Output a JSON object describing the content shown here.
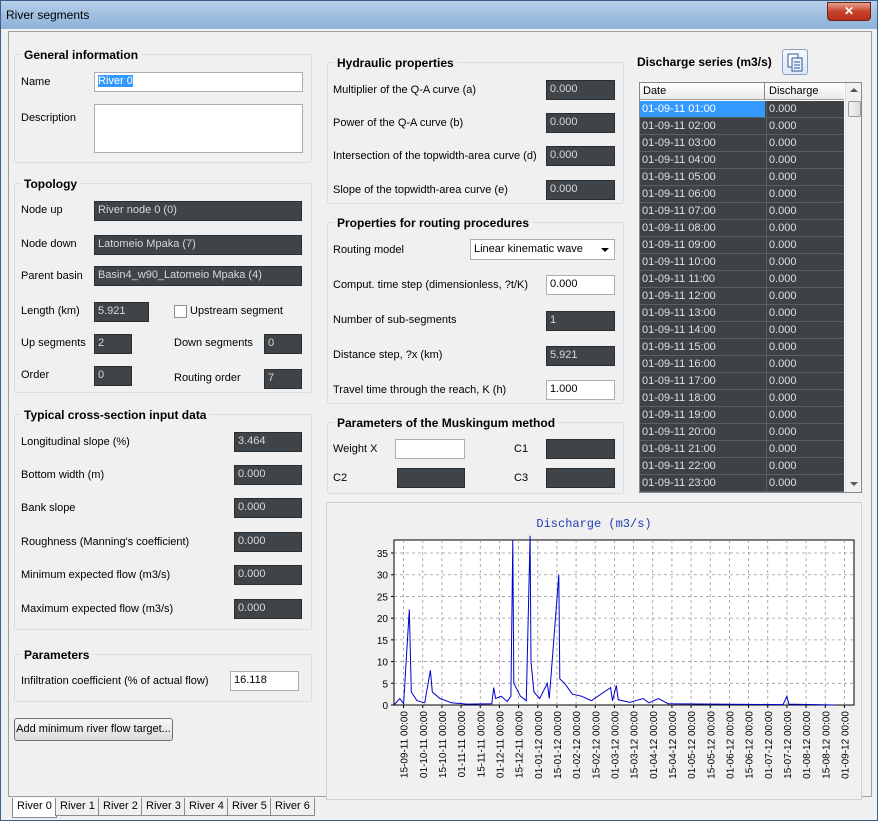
{
  "window": {
    "title": "River segments",
    "close_label": "✕"
  },
  "general": {
    "title": "General information",
    "name_label": "Name",
    "name_value": "River 0",
    "description_label": "Description",
    "description_value": ""
  },
  "topology": {
    "title": "Topology",
    "node_up_label": "Node up",
    "node_up_value": "River node 0 (0)",
    "node_down_label": "Node down",
    "node_down_value": "Latomeio Mpaka (7)",
    "parent_basin_label": "Parent basin",
    "parent_basin_value": "Basin4_w90_Latomeio Mpaka (4)",
    "length_label": "Length (km)",
    "length_value": "5.921",
    "upstream_label": "Upstream segment",
    "up_segments_label": "Up segments",
    "up_segments_value": "2",
    "down_segments_label": "Down segments",
    "down_segments_value": "0",
    "order_label": "Order",
    "order_value": "0",
    "routing_order_label": "Routing order",
    "routing_order_value": "7"
  },
  "cross_section": {
    "title": "Typical cross-section input data",
    "rows": [
      {
        "label": "Longitudinal slope (%)",
        "value": "3.464"
      },
      {
        "label": "Bottom width (m)",
        "value": "0.000"
      },
      {
        "label": "Bank slope",
        "value": "0.000"
      },
      {
        "label": "Roughness (Manning's coefficient)",
        "value": "0.000"
      },
      {
        "label": "Minimum expected flow (m3/s)",
        "value": "0.000"
      },
      {
        "label": "Maximum expected flow (m3/s)",
        "value": "0.000"
      }
    ]
  },
  "parameters": {
    "title": "Parameters",
    "infiltration_label": "Infiltration coefficient (% of actual flow)",
    "infiltration_value": "16.118"
  },
  "add_target_button": "Add minimum river flow target...",
  "hydraulic": {
    "title": "Hydraulic properties",
    "rows": [
      {
        "label": "Multiplier of the Q-A curve (a)",
        "value": "0.000"
      },
      {
        "label": "Power of the Q-A curve (b)",
        "value": "0.000"
      },
      {
        "label": "Intersection of the topwidth-area curve (d)",
        "value": "0.000"
      },
      {
        "label": "Slope of the topwidth-area curve (e)",
        "value": "0.000"
      }
    ]
  },
  "routing": {
    "title": "Properties for routing procedures",
    "model_label": "Routing model",
    "model_value": "Linear kinematic wave",
    "time_step_label": "Comput. time step (dimensionless, ?t/K)",
    "time_step_value": "0.000",
    "sub_segments_label": "Number of sub-segments",
    "sub_segments_value": "1",
    "distance_label": "Distance step, ?x (km)",
    "distance_value": "5.921",
    "travel_label": "Travel time through the reach, K (h)",
    "travel_value": "1.000"
  },
  "muskingum": {
    "title": "Parameters of the Muskingum method",
    "weight_label": "Weight X",
    "weight_value": "",
    "c1_label": "C1",
    "c1_value": "",
    "c2_label": "C2",
    "c2_value": "",
    "c3_label": "C3",
    "c3_value": ""
  },
  "discharge": {
    "title": "Discharge series (m3/s)",
    "col_date": "Date",
    "col_value": "Discharge",
    "rows": [
      {
        "date": "01-09-11 01:00",
        "value": "0.000"
      },
      {
        "date": "01-09-11 02:00",
        "value": "0.000"
      },
      {
        "date": "01-09-11 03:00",
        "value": "0.000"
      },
      {
        "date": "01-09-11 04:00",
        "value": "0.000"
      },
      {
        "date": "01-09-11 05:00",
        "value": "0.000"
      },
      {
        "date": "01-09-11 06:00",
        "value": "0.000"
      },
      {
        "date": "01-09-11 07:00",
        "value": "0.000"
      },
      {
        "date": "01-09-11 08:00",
        "value": "0.000"
      },
      {
        "date": "01-09-11 09:00",
        "value": "0.000"
      },
      {
        "date": "01-09-11 10:00",
        "value": "0.000"
      },
      {
        "date": "01-09-11 11:00",
        "value": "0.000"
      },
      {
        "date": "01-09-11 12:00",
        "value": "0.000"
      },
      {
        "date": "01-09-11 13:00",
        "value": "0.000"
      },
      {
        "date": "01-09-11 14:00",
        "value": "0.000"
      },
      {
        "date": "01-09-11 15:00",
        "value": "0.000"
      },
      {
        "date": "01-09-11 16:00",
        "value": "0.000"
      },
      {
        "date": "01-09-11 17:00",
        "value": "0.000"
      },
      {
        "date": "01-09-11 18:00",
        "value": "0.000"
      },
      {
        "date": "01-09-11 19:00",
        "value": "0.000"
      },
      {
        "date": "01-09-11 20:00",
        "value": "0.000"
      },
      {
        "date": "01-09-11 21:00",
        "value": "0.000"
      },
      {
        "date": "01-09-11 22:00",
        "value": "0.000"
      },
      {
        "date": "01-09-11 23:00",
        "value": "0.000"
      }
    ]
  },
  "tabs": [
    "River 0",
    "River 1",
    "River 2",
    "River 3",
    "River 4",
    "River 5",
    "River 6"
  ],
  "colors": {
    "readonly_bg": "#3f4448",
    "selection": "#3399ff",
    "series": "#0000cc"
  },
  "chart_data": {
    "type": "line",
    "title": "Discharge (m3/s)",
    "xlabel": "",
    "ylabel": "",
    "ylim": [
      0,
      38
    ],
    "yticks": [
      0,
      5,
      10,
      15,
      20,
      25,
      30,
      35
    ],
    "xticks": [
      "15-09-11 00:00",
      "01-10-11 00:00",
      "15-10-11 00:00",
      "01-11-11 00:00",
      "15-11-11 00:00",
      "01-12-11 00:00",
      "15-12-11 00:00",
      "01-01-12 00:00",
      "15-01-12 00:00",
      "01-02-12 00:00",
      "15-02-12 00:00",
      "01-03-12 00:00",
      "15-03-12 00:00",
      "01-04-12 00:00",
      "15-04-12 00:00",
      "01-05-12 00:00",
      "15-05-12 00:00",
      "01-06-12 00:00",
      "15-06-12 00:00",
      "01-07-12 00:00",
      "15-07-12 00:00",
      "01-08-12 00:00",
      "15-08-12 00:00",
      "01-09-12 00:00"
    ],
    "grid": true,
    "series": [
      {
        "color": "#0000cc",
        "points": [
          [
            0,
            0
          ],
          [
            0.3,
            1.5
          ],
          [
            0.5,
            0.3
          ],
          [
            0.8,
            22
          ],
          [
            0.9,
            3
          ],
          [
            1.2,
            1
          ],
          [
            1.6,
            0.5
          ],
          [
            1.9,
            8
          ],
          [
            2.0,
            3
          ],
          [
            2.4,
            1.5
          ],
          [
            3,
            0.5
          ],
          [
            3.8,
            0.2
          ],
          [
            5.1,
            0.3
          ],
          [
            5.2,
            4
          ],
          [
            5.3,
            1.5
          ],
          [
            5.6,
            2
          ],
          [
            5.9,
            0.8
          ],
          [
            6.1,
            2
          ],
          [
            6.2,
            38
          ],
          [
            6.25,
            5
          ],
          [
            6.6,
            2
          ],
          [
            6.9,
            1
          ],
          [
            7.1,
            39
          ],
          [
            7.15,
            10
          ],
          [
            7.3,
            3
          ],
          [
            7.6,
            1.5
          ],
          [
            8.0,
            5
          ],
          [
            8.1,
            1.5
          ],
          [
            8.6,
            30
          ],
          [
            8.65,
            6
          ],
          [
            8.9,
            5
          ],
          [
            9.3,
            2.5
          ],
          [
            9.8,
            2
          ],
          [
            10.3,
            1
          ],
          [
            11.3,
            4
          ],
          [
            11.4,
            1
          ],
          [
            11.6,
            4.5
          ],
          [
            11.7,
            1.2
          ],
          [
            12.3,
            0.6
          ],
          [
            13.0,
            1.5
          ],
          [
            13.3,
            0.5
          ],
          [
            13.8,
            1.5
          ],
          [
            14.3,
            0.3
          ],
          [
            20.3,
            0.1
          ],
          [
            20.5,
            2
          ],
          [
            20.6,
            0.2
          ],
          [
            23,
            0
          ]
        ]
      }
    ]
  }
}
